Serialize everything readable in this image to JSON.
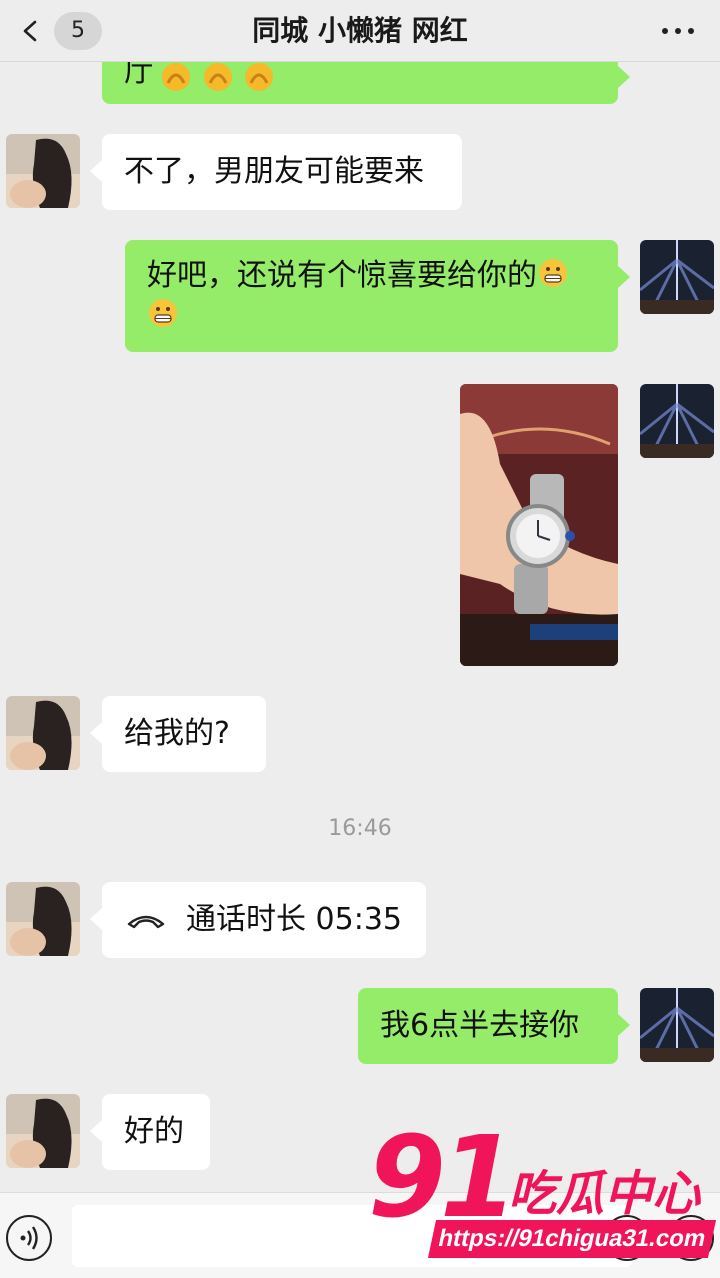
{
  "header": {
    "title": "同城 小懒猪 网红",
    "unread_count": "5",
    "back_icon": "chevron-left-icon",
    "more_icon": "more-horizontal-icon"
  },
  "messages": [
    {
      "side": "out",
      "type": "text",
      "text": "厅",
      "emoji": [
        "thumbs-up",
        "thumbs-up",
        "thumbs-up"
      ]
    },
    {
      "side": "in",
      "type": "text",
      "text": "不了，男朋友可能要来"
    },
    {
      "side": "out",
      "type": "text",
      "text": "好吧，还说有个惊喜要给你的",
      "emoji": [
        "grimacing-face",
        "grimacing-face"
      ]
    },
    {
      "side": "out",
      "type": "image"
    },
    {
      "side": "in",
      "type": "text",
      "text": "给我的?"
    },
    {
      "type": "timestamp",
      "text": "16:46"
    },
    {
      "side": "in",
      "type": "call",
      "text": "通话时长 05:35"
    },
    {
      "side": "out",
      "type": "text",
      "text": "我6点半去接你"
    },
    {
      "side": "in",
      "type": "text",
      "text": "好的"
    }
  ],
  "bottom_bar": {
    "voice_icon": "voice-icon",
    "emoji_icon": "smile-icon",
    "plus_icon": "plus-icon"
  },
  "watermark": {
    "logo": "91",
    "name": "吃瓜中心",
    "url": "https://91chigua31.com"
  },
  "colors": {
    "outgoing_bubble": "#95ec69",
    "incoming_bubble": "#ffffff",
    "background": "#ededed",
    "watermark": "#f0145a"
  }
}
